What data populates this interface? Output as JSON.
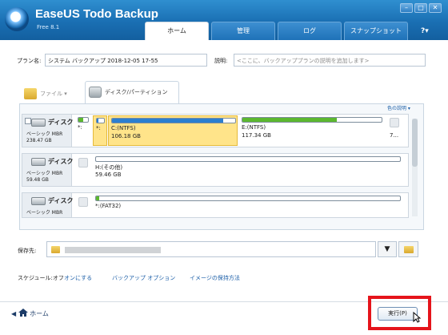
{
  "app": {
    "title": "EaseUS Todo Backup",
    "edition": "Free 8.1",
    "window_controls": {
      "minimize": "–",
      "maximize": "□",
      "close": "✕"
    }
  },
  "tabs": [
    {
      "label": "ホーム",
      "active": true
    },
    {
      "label": "管理",
      "active": false
    },
    {
      "label": "ログ",
      "active": false
    },
    {
      "label": "スナップショット",
      "active": false
    }
  ],
  "help": {
    "label": "?▾"
  },
  "plan": {
    "name_label": "プラン名:",
    "name_value": "システム バックアップ 2018-12-05 17-55",
    "desc_label": "説明:",
    "desc_placeholder": "<ここに、バックアッププランの説明を追加します>"
  },
  "source_tabs": [
    {
      "label": "ファイル ▾",
      "icon": "folder-icon",
      "active": false
    },
    {
      "label": "ディスク/パーティション",
      "icon": "disk-icon",
      "active": true
    }
  ],
  "legend_link": "色の説明 ▾",
  "disks": [
    {
      "name": "ディスク",
      "type": "ベーシック MBR",
      "size": "238.47 GB",
      "partitions": [
        {
          "name": "*:",
          "size": "",
          "dots": "",
          "selected": false,
          "used": 0.5
        },
        {
          "name": "*:",
          "size": "",
          "dots": "",
          "selected": true,
          "used": 0.2
        },
        {
          "name": "C:(NTFS)",
          "size": "106.18 GB",
          "dots": "",
          "selected": true,
          "used": 0.9
        },
        {
          "name": "E:(NTFS)",
          "size": "117.34 GB",
          "dots": "",
          "selected": false,
          "used": 0.68
        },
        {
          "name": "",
          "size": "",
          "dots": "7...",
          "selected": false,
          "used": 0
        }
      ]
    },
    {
      "name": "ディスク",
      "type": "ベーシック MBR",
      "size": "59.48 GB",
      "partitions": [
        {
          "name": "H:(その他)",
          "size": "59.46 GB",
          "dots": "",
          "selected": false,
          "used": 0.0
        }
      ]
    },
    {
      "name": "ディスク",
      "type": "ベーシック MBR",
      "size": "",
      "partitions": [
        {
          "name": "*:(FAT32)",
          "size": "",
          "dots": "",
          "selected": false,
          "used": 0.01
        }
      ]
    }
  ],
  "destination": {
    "label": "保存先:",
    "dropdown": "▼"
  },
  "options": {
    "schedule_label": "スケジュール:オフ",
    "schedule_link": "オンにする",
    "backup_options": "バックアップ オプション",
    "retention": "イメージの保持方法"
  },
  "footer": {
    "home_label": "ホーム",
    "proceed_label": "実行(P)"
  },
  "colors": {
    "titlebar": "#1a6fb3",
    "accent_link": "#1c5fa8",
    "used_blue": "#2b7fd0",
    "used_green": "#5cb82f",
    "selected": "#ffe48a",
    "highlight": "#e5141b"
  }
}
